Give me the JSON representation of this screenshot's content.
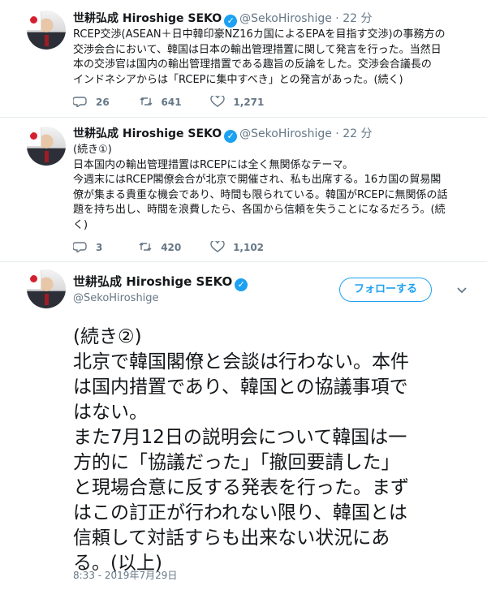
{
  "tweets": [
    {
      "name": "世耕弘成 Hiroshige SEKO",
      "handle": "@SekoHiroshige",
      "dot": "·",
      "time": "22 分",
      "lines": [
        "RCEP交渉(ASEAN＋日中韓印豪NZ16カ国によるEPAを目指す交渉)の事務方の",
        "交渉会合において、韓国は日本の輸出管理措置に関して発言を行った。当然日",
        "本の交渉官は国内の輸出管理措置である趣旨の反論をした。交渉会合議長の",
        "インドネシアからは「RCEPに集中すべき」との発言があった。(続く)"
      ],
      "replies": "26",
      "retweets": "641",
      "likes": "1,271"
    },
    {
      "name": "世耕弘成 Hiroshige SEKO",
      "handle": "@SekoHiroshige",
      "dot": "·",
      "time": "22 分",
      "lines": [
        "(続き①)",
        "日本国内の輸出管理措置はRCEPには全く無関係なテーマ。",
        "今週末にはRCEP閣僚会合が北京で開催され、私も出席する。16カ国の貿易閣",
        "僚が集まる貴重な機会であり、時間も限られている。韓国がRCEPに無関係の話",
        "題を持ち出し、時間を浪費したら、各国から信頼を失うことになるだろう。(続",
        "く)"
      ],
      "replies": "3",
      "retweets": "420",
      "likes": "1,102"
    }
  ],
  "main_tweet": {
    "name": "世耕弘成 Hiroshige SEKO",
    "handle": "@SekoHiroshige",
    "follow_label": "フォローする",
    "lines": [
      "(続き②)",
      "北京で韓国閣僚と会談は行わない。本件",
      "は国内措置であり、韓国との協議事項で",
      "はない。",
      "また7月12日の説明会について韓国は一",
      "方的に「協議だった」「撤回要請した」",
      "と現場合意に反する発表を行った。まず",
      "はこの訂正が行われない限り、韓国とは",
      "信頼して対話すらも出来ない状況にあ",
      "る。(以上)"
    ],
    "timestamp": "8:33 - 2019年7月29日"
  },
  "icons": {
    "verified": "verified-badge-icon",
    "reply": "reply-icon",
    "retweet": "retweet-icon",
    "like": "heart-icon",
    "caret": "chevron-down-icon"
  },
  "colors": {
    "accent": "#1da1f2",
    "muted": "#657786",
    "text": "#14171a"
  }
}
